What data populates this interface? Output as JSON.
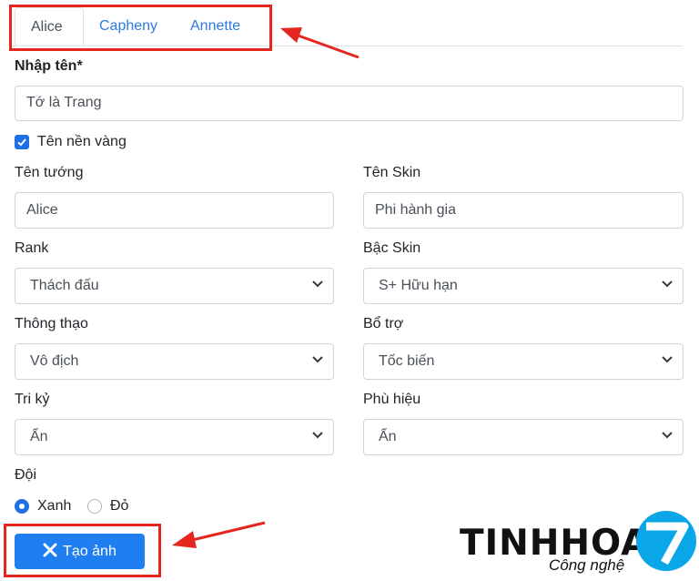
{
  "tabs": [
    {
      "label": "Alice",
      "active": true
    },
    {
      "label": "Capheny",
      "active": false
    },
    {
      "label": "Annette",
      "active": false
    }
  ],
  "name": {
    "label": "Nhập tên*",
    "value": "Tớ là Trang"
  },
  "golden_name": {
    "label": "Tên nền vàng",
    "checked": true
  },
  "hero": {
    "label": "Tên tướng",
    "value": "Alice"
  },
  "skin": {
    "label": "Tên Skin",
    "value": "Phi hành gia"
  },
  "rank": {
    "label": "Rank",
    "value": "Thách đấu"
  },
  "skin_tier": {
    "label": "Bậc Skin",
    "value": "S+ Hữu hạn"
  },
  "mastery": {
    "label": "Thông thạo",
    "value": "Vô địch"
  },
  "spell": {
    "label": "Bổ trợ",
    "value": "Tốc biến"
  },
  "soulmate": {
    "label": "Tri kỷ",
    "value": "Ẩn"
  },
  "badge": {
    "label": "Phù hiệu",
    "value": "Ẩn"
  },
  "team": {
    "label": "Đội",
    "options": [
      {
        "label": "Xanh",
        "selected": true
      },
      {
        "label": "Đỏ",
        "selected": false
      }
    ]
  },
  "submit": {
    "label": "Tạo ảnh",
    "icon": "tools-icon"
  },
  "brand": {
    "name": "TINHHOA",
    "number": "7",
    "tagline": "Công nghệ"
  },
  "colors": {
    "accent": "#1f7ef0",
    "highlight": "#e5261f",
    "link": "#2b7be4"
  }
}
